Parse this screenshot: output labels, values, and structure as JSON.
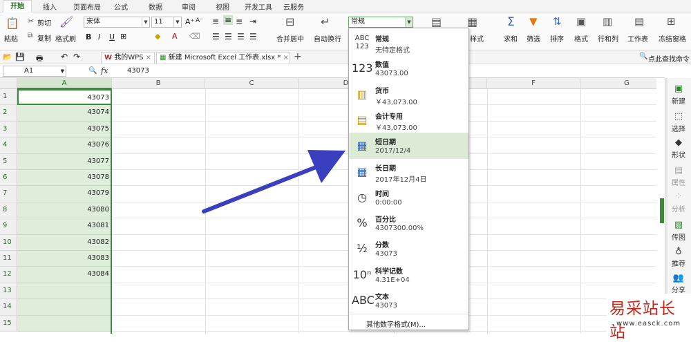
{
  "menubar": {
    "tabs": [
      "开始",
      "插入",
      "页面布局",
      "公式",
      "数据",
      "审阅",
      "视图",
      "开发工具",
      "云服务"
    ]
  },
  "ribbon": {
    "paste_label": "粘贴",
    "cut_label": "剪切",
    "copy_label": "复制",
    "format_painter_label": "格式刷",
    "font_name": "宋体",
    "font_size": "11",
    "bold": "B",
    "italic": "I",
    "underline": "U",
    "merge_label": "合并居中",
    "wrap_label": "自动换行",
    "number_format": "常规",
    "styles_label": "样式",
    "sum_label": "求和",
    "filter_label": "筛选",
    "sort_label": "排序",
    "format_label": "格式",
    "rowcol_label": "行和列",
    "sheet_label": "工作表",
    "freeze_label": "冻结窗格"
  },
  "qabar": {
    "tab1_label": "我的WPS",
    "tab2_label": "新建 Microsoft Excel 工作表.xlsx *",
    "find_label": "点此查找命令"
  },
  "formulabar": {
    "name_box": "A1",
    "fx": "fx",
    "value": "43073"
  },
  "sheet": {
    "columns": [
      "A",
      "B",
      "C",
      "D",
      "E",
      "F",
      "G"
    ],
    "rows": [
      "1",
      "2",
      "3",
      "4",
      "5",
      "6",
      "7",
      "8",
      "9",
      "10",
      "11",
      "12",
      "13",
      "14",
      "15"
    ],
    "col_a_values": [
      "43073",
      "43074",
      "43075",
      "43076",
      "43077",
      "43078",
      "43079",
      "43080",
      "43081",
      "43082",
      "43083",
      "43084"
    ]
  },
  "dropdown": {
    "items": [
      {
        "icon": "ABC\n123",
        "name": "常规",
        "sample": "无特定格式"
      },
      {
        "icon": "123",
        "name": "数值",
        "sample": "43073.00"
      },
      {
        "icon": "currency-icon",
        "name": "货币",
        "sample": "￥43,073.00"
      },
      {
        "icon": "accounting-icon",
        "name": "会计专用",
        "sample": " ￥43,073.00"
      },
      {
        "icon": "calendar-icon",
        "name": "短日期",
        "sample": "2017/12/4"
      },
      {
        "icon": "calendar-icon",
        "name": "长日期",
        "sample": "2017年12月4日"
      },
      {
        "icon": "clock-icon",
        "name": "时间",
        "sample": "0:00:00"
      },
      {
        "icon": "%",
        "name": "百分比",
        "sample": "4307300.00%"
      },
      {
        "icon": "½",
        "name": "分数",
        "sample": "43073"
      },
      {
        "icon": "10ⁿ",
        "name": "科学记数",
        "sample": "4.31E+04"
      },
      {
        "icon": "ABC",
        "name": "文本",
        "sample": "43073"
      }
    ],
    "more_label": "其他数字格式(M)..."
  },
  "rightpanel": {
    "items": [
      "新建",
      "选择",
      "形状",
      "属性",
      "分析",
      "传图",
      "推荐",
      "分享"
    ]
  },
  "watermark": {
    "title": "易采站长站",
    "url": "www.easck.com"
  },
  "colors": {
    "selected_col": "#dfeedb",
    "highlight_item": "#dcebd6",
    "arrow": "#3a3fbf"
  }
}
